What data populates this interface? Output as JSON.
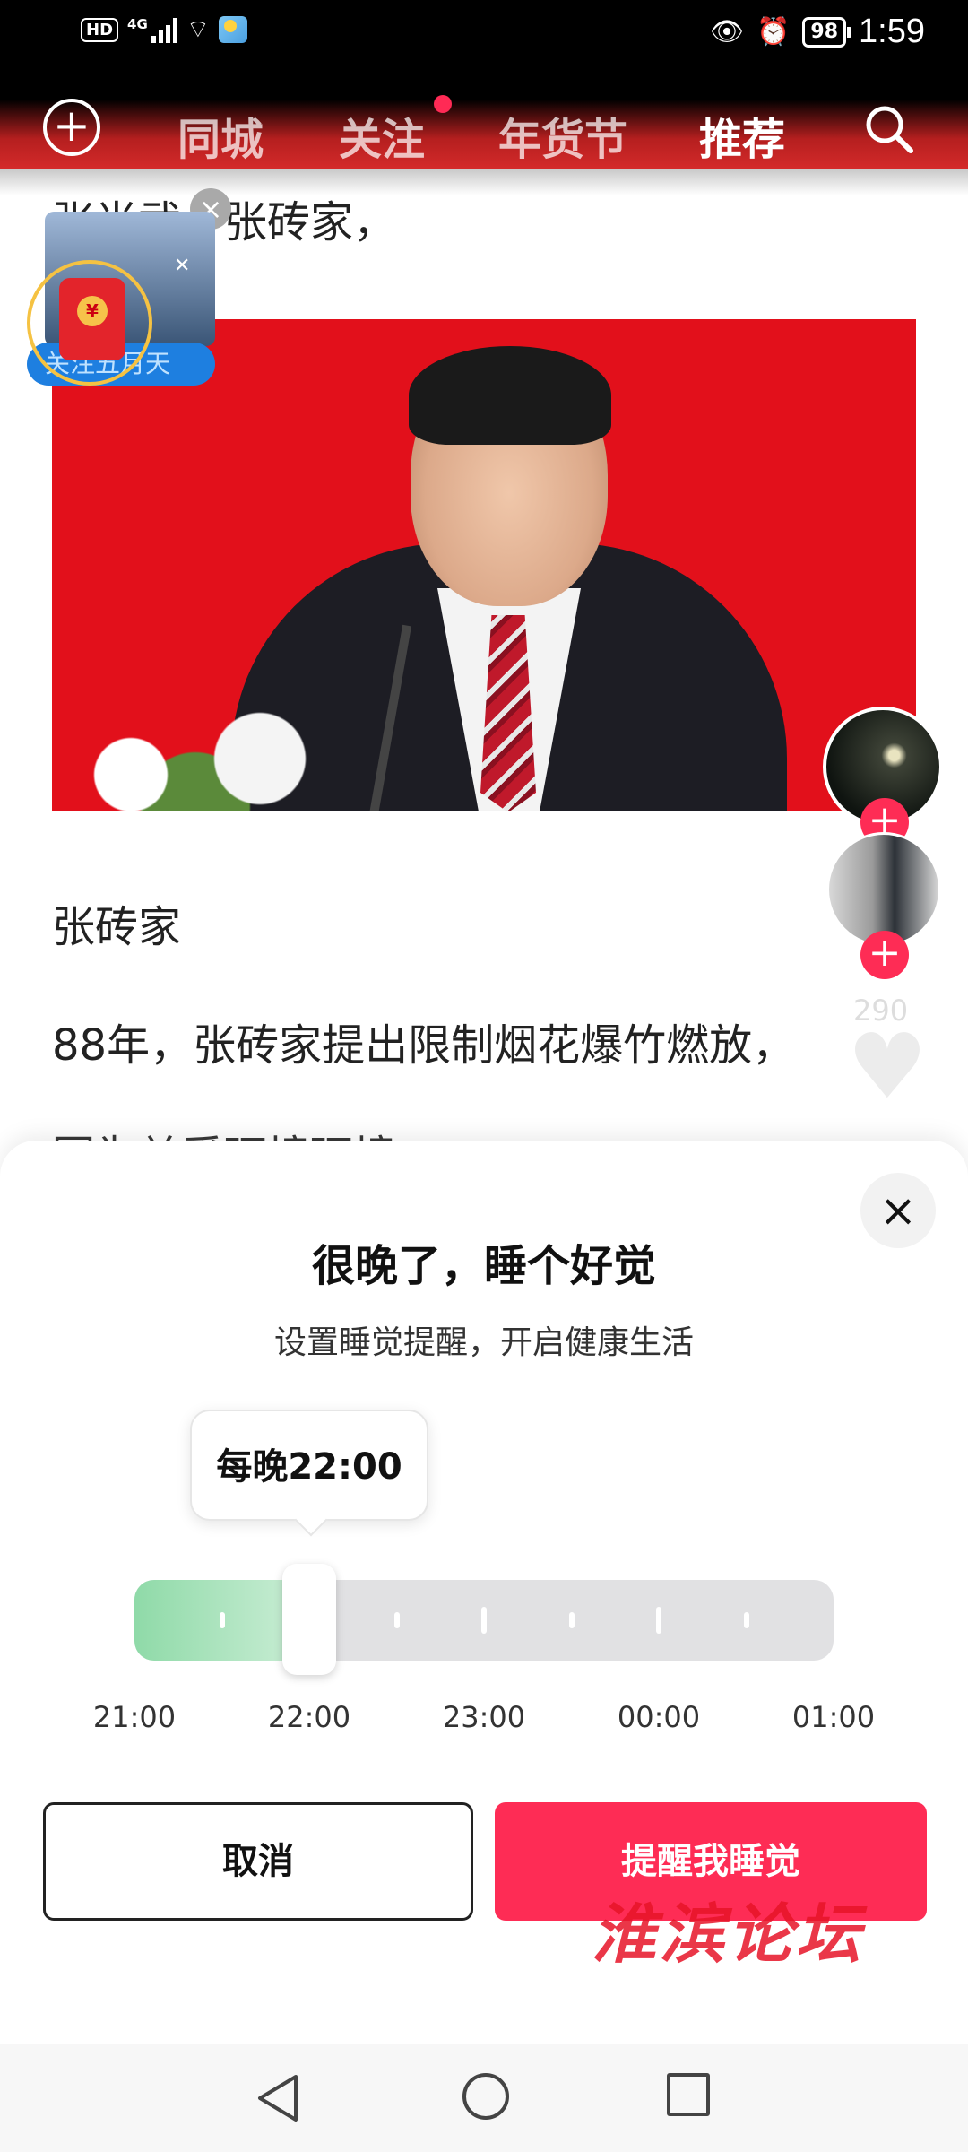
{
  "status_bar": {
    "hd": "HD",
    "network": "4G",
    "battery": "98",
    "time": "1:59"
  },
  "top_nav": {
    "tabs": [
      {
        "label": "同城",
        "active": false
      },
      {
        "label": "关注",
        "active": false,
        "has_dot": true
      },
      {
        "label": "年货节",
        "active": false
      },
      {
        "label": "推荐",
        "active": true
      }
    ]
  },
  "feed": {
    "line1": "张尚武，张砖家，",
    "heading": "张砖家",
    "paragraph": "88年，张砖家提出限制烟花爆竹燃放，",
    "paragraph_cut": "因为关爱环境环境"
  },
  "red_packet": {
    "banner": "关注五月天",
    "coin": "¥"
  },
  "side_rail": {
    "like_count": "290"
  },
  "sheet": {
    "title": "很晚了，睡个好觉",
    "subtitle": "设置睡觉提醒，开启健康生活",
    "tooltip": "每晚22:00",
    "slider": {
      "labels": [
        "21:00",
        "22:00",
        "23:00",
        "00:00",
        "01:00"
      ],
      "selected": "22:00",
      "selected_fraction": 0.25
    },
    "cancel_label": "取消",
    "confirm_label": "提醒我睡觉"
  },
  "watermark": "淮滨论坛",
  "colors": {
    "accent": "#fe2c55",
    "slider_fill": "#8fdaa8",
    "photo_bg": "#e2101b"
  }
}
